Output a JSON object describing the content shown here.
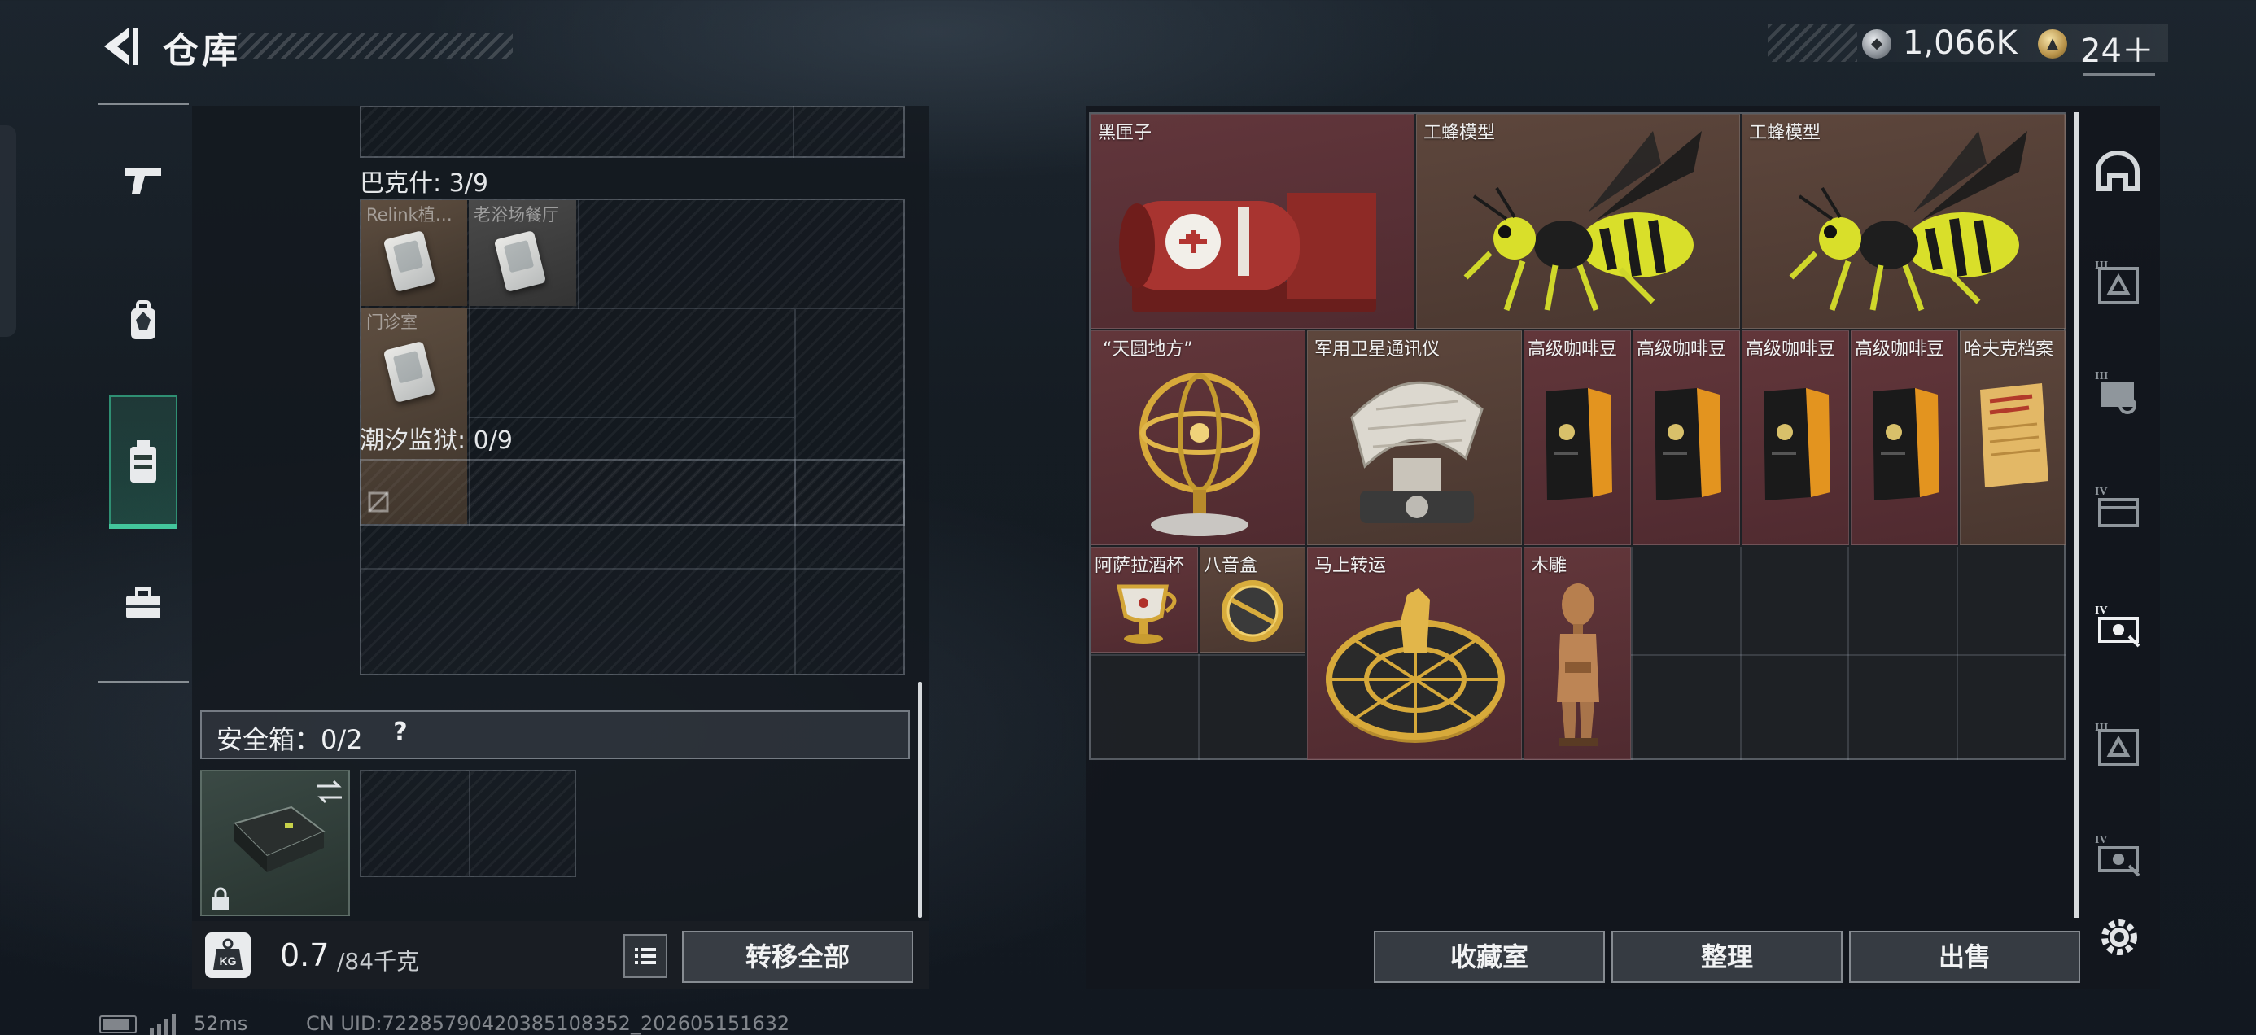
{
  "header": {
    "title": "仓库",
    "currencies": [
      {
        "name": "silver-coin",
        "amount": "1,066K"
      },
      {
        "name": "gold-coin",
        "amount": "24＋"
      }
    ]
  },
  "left_nav": {
    "items": [
      {
        "icon": "pistol-icon"
      },
      {
        "icon": "backpack-icon"
      },
      {
        "icon": "chest-rig-icon",
        "active": true
      },
      {
        "icon": "briefcase-icon"
      }
    ]
  },
  "backpack": {
    "sections": [
      {
        "label": "巴克什: 3/9",
        "items": [
          {
            "name": "Relink植…"
          },
          {
            "name": "老浴场餐厅"
          },
          {
            "name": "门诊室"
          }
        ]
      },
      {
        "label": "潮汐监狱: 0/9",
        "items": []
      }
    ],
    "safe_box": {
      "label": "安全箱：0/2",
      "help": "?"
    },
    "weight": {
      "current": "0.7",
      "max": "/84千克"
    },
    "transfer_all": "转移全部"
  },
  "storage": {
    "items": [
      {
        "label": "黑匣子",
        "tone": "red"
      },
      {
        "label": "工蜂模型",
        "tone": "brown"
      },
      {
        "label": "工蜂模型",
        "tone": "brown"
      },
      {
        "label": "“天圆地方”",
        "tone": "red"
      },
      {
        "label": "军用卫星通讯仪",
        "tone": "brown"
      },
      {
        "label": "高级咖啡豆",
        "tone": "red"
      },
      {
        "label": "高级咖啡豆",
        "tone": "red"
      },
      {
        "label": "高级咖啡豆",
        "tone": "red"
      },
      {
        "label": "高级咖啡豆",
        "tone": "red"
      },
      {
        "label": "哈夫克档案",
        "tone": "brown"
      },
      {
        "label": "阿萨拉酒杯",
        "tone": "red"
      },
      {
        "label": "八音盒",
        "tone": "brown"
      },
      {
        "label": "马上转运",
        "tone": "red"
      },
      {
        "label": "木雕",
        "tone": "red"
      }
    ],
    "buttons": {
      "collection": "收藏室",
      "sort": "整理",
      "sell": "出售"
    }
  },
  "side_tabs": [
    {
      "icon": "helmet-icon"
    },
    {
      "icon": "tier-3-armor-icon",
      "tier": "III"
    },
    {
      "icon": "tier-3-rig-icon",
      "tier": "III"
    },
    {
      "icon": "tier-4-case-icon",
      "tier": "IV"
    },
    {
      "icon": "tier-4-gear-icon",
      "tier": "IV"
    },
    {
      "icon": "tier-3-armor-icon",
      "tier": "III"
    },
    {
      "icon": "tier-4-gear-icon",
      "tier": "IV"
    }
  ],
  "status_bar": {
    "ping": "52ms",
    "uid": "CN UID:7228579042038510835​2_202605151632"
  },
  "colors": {
    "accent_green": "#43c69c",
    "item_red": "#783e42",
    "item_brown": "#785646"
  }
}
